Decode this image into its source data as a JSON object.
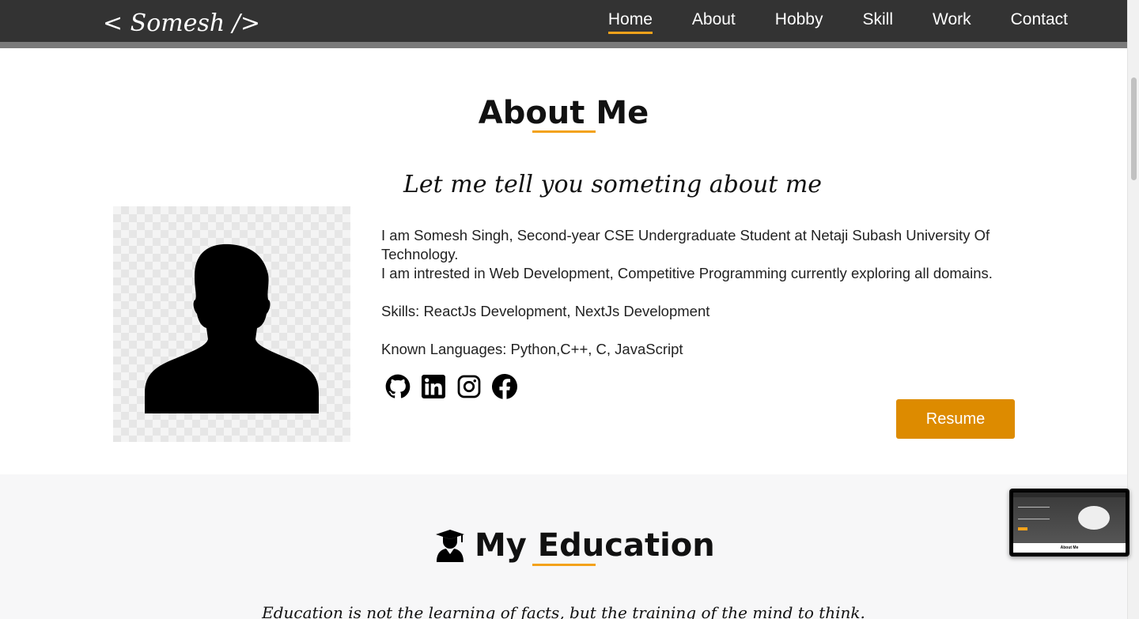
{
  "navbar": {
    "brand": "< Somesh />",
    "items": [
      {
        "label": "Home",
        "active": true
      },
      {
        "label": "About",
        "active": false
      },
      {
        "label": "Hobby",
        "active": false
      },
      {
        "label": "Skill",
        "active": false
      },
      {
        "label": "Work",
        "active": false
      },
      {
        "label": "Contact",
        "active": false
      }
    ]
  },
  "about": {
    "title": "About Me",
    "tagline": "Let me tell you someting about me",
    "bio_line1": "I am Somesh Singh, Second-year CSE Undergraduate Student at Netaji Subash University Of Technology.",
    "bio_line2": "I am intrested in Web Development, Competitive Programming currently exploring all domains.",
    "skills": "Skills: ReactJs Development, NextJs Development",
    "languages": "Known Languages: Python,C++, C, JavaScript",
    "socials": [
      "github-icon",
      "linkedin-icon",
      "instagram-icon",
      "facebook-icon"
    ],
    "resume_label": "Resume"
  },
  "education": {
    "title": "My Education",
    "quote": "Education is not the learning of facts, but the training of the mind to think."
  },
  "preview": {
    "footer_label": "About Me"
  },
  "colors": {
    "accent": "#f3a21b",
    "resume_button": "#dd8b00",
    "navbar": "#333333"
  }
}
